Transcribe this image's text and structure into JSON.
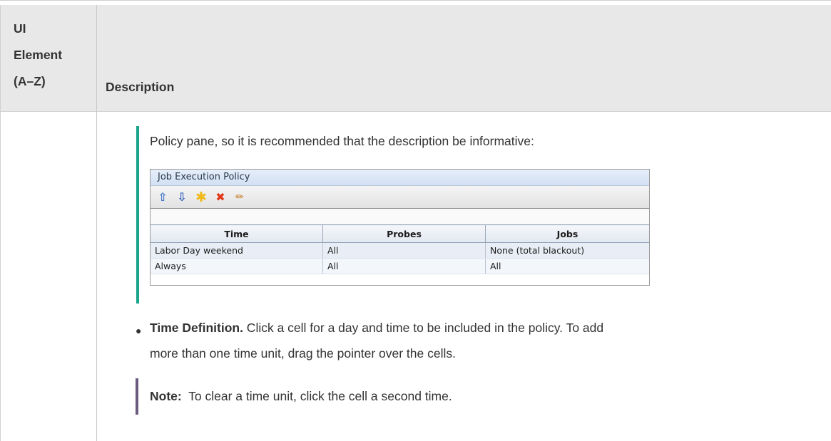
{
  "header": {
    "col1_line1": "UI",
    "col1_line2": "Element",
    "col1_line3": "(A–Z)",
    "col2": "Description"
  },
  "body": {
    "intro_text": "Policy pane, so it is recommended that the description be informative:",
    "time_definition_label": "Time Definition.",
    "time_definition_text1": " Click a cell for a day and time to be included in the policy. To add",
    "time_definition_text2": "more than one time unit, drag the pointer over the cells.",
    "note_label": "Note:",
    "note_text": "  To clear a time unit, click the cell a second time."
  },
  "screenshot": {
    "title": "Job Execution Policy",
    "toolbar_icons": [
      "arrow-up-icon",
      "arrow-down-icon",
      "new-icon",
      "delete-icon",
      "edit-icon"
    ],
    "columns": [
      "Time",
      "Probes",
      "Jobs"
    ],
    "rows": [
      [
        "Labor Day weekend",
        "All",
        "None (total blackout)"
      ],
      [
        "Always",
        "All",
        "All"
      ]
    ]
  },
  "colors": {
    "note_bar": "#6b5a80",
    "example_bar": "#1aa58c",
    "header_bg": "#e8e8e8"
  }
}
